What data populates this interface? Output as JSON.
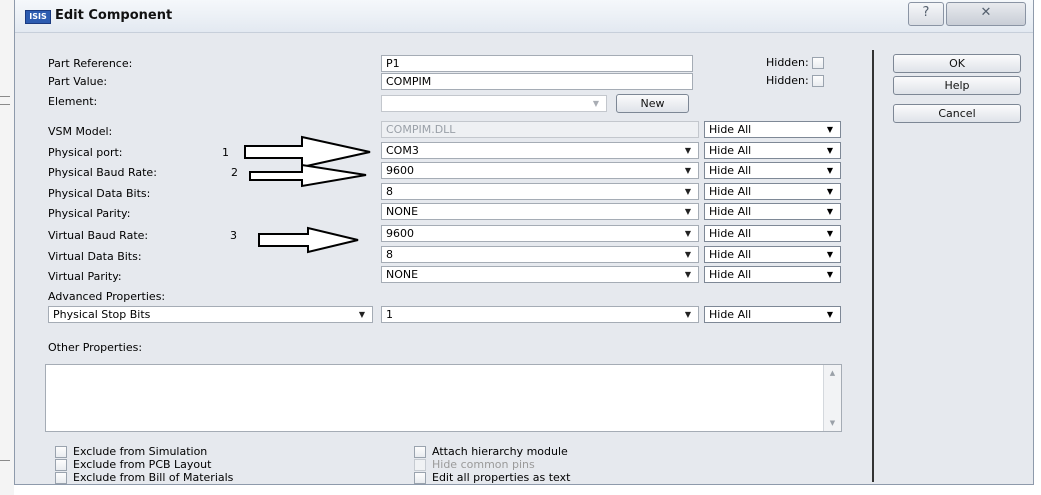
{
  "window": {
    "title": "Edit Component",
    "app_icon_text": "ISIS",
    "title_buttons": [
      "?",
      "✕"
    ]
  },
  "fields": {
    "part_reference": {
      "label": "Part Reference:",
      "value": "P1",
      "hidden_label": "Hidden:"
    },
    "part_value": {
      "label": "Part Value:",
      "value": "COMPIM",
      "hidden_label": "Hidden:"
    },
    "element": {
      "label": "Element:",
      "value": "",
      "new_button": "New"
    },
    "vsm_model": {
      "label": "VSM Model:",
      "value": "COMPIM.DLL",
      "hide": "Hide All"
    },
    "physical_port": {
      "label": "Physical port:",
      "value": "COM3",
      "hide": "Hide All",
      "marker": "1"
    },
    "physical_baud_rate": {
      "label": "Physical Baud Rate:",
      "value": "9600",
      "hide": "Hide All",
      "marker": "2"
    },
    "physical_data_bits": {
      "label": "Physical Data Bits:",
      "value": "8",
      "hide": "Hide All"
    },
    "physical_parity": {
      "label": "Physical Parity:",
      "value": "NONE",
      "hide": "Hide All"
    },
    "virtual_baud_rate": {
      "label": "Virtual Baud Rate:",
      "value": "9600",
      "hide": "Hide All",
      "marker": "3"
    },
    "virtual_data_bits": {
      "label": "Virtual Data Bits:",
      "value": "8",
      "hide": "Hide All"
    },
    "virtual_parity": {
      "label": "Virtual Parity:",
      "value": "NONE",
      "hide": "Hide All"
    }
  },
  "advanced": {
    "label": "Advanced Properties:",
    "property": "Physical Stop Bits",
    "value": "1",
    "hide": "Hide All"
  },
  "other_properties": {
    "label": "Other Properties:",
    "text": ""
  },
  "checkboxes": {
    "exclude_simulation": "Exclude from Simulation",
    "exclude_pcb": "Exclude from PCB Layout",
    "exclude_bom": "Exclude from Bill of Materials",
    "attach_hierarchy": "Attach hierarchy module",
    "hide_common_pins": "Hide common pins",
    "edit_all_text": "Edit all properties as text"
  },
  "buttons": {
    "ok": "OK",
    "help": "Help",
    "cancel": "Cancel"
  },
  "icons": {
    "dropdown": "dropdown-arrow-icon",
    "arrow": "right-outline-arrow-icon"
  }
}
